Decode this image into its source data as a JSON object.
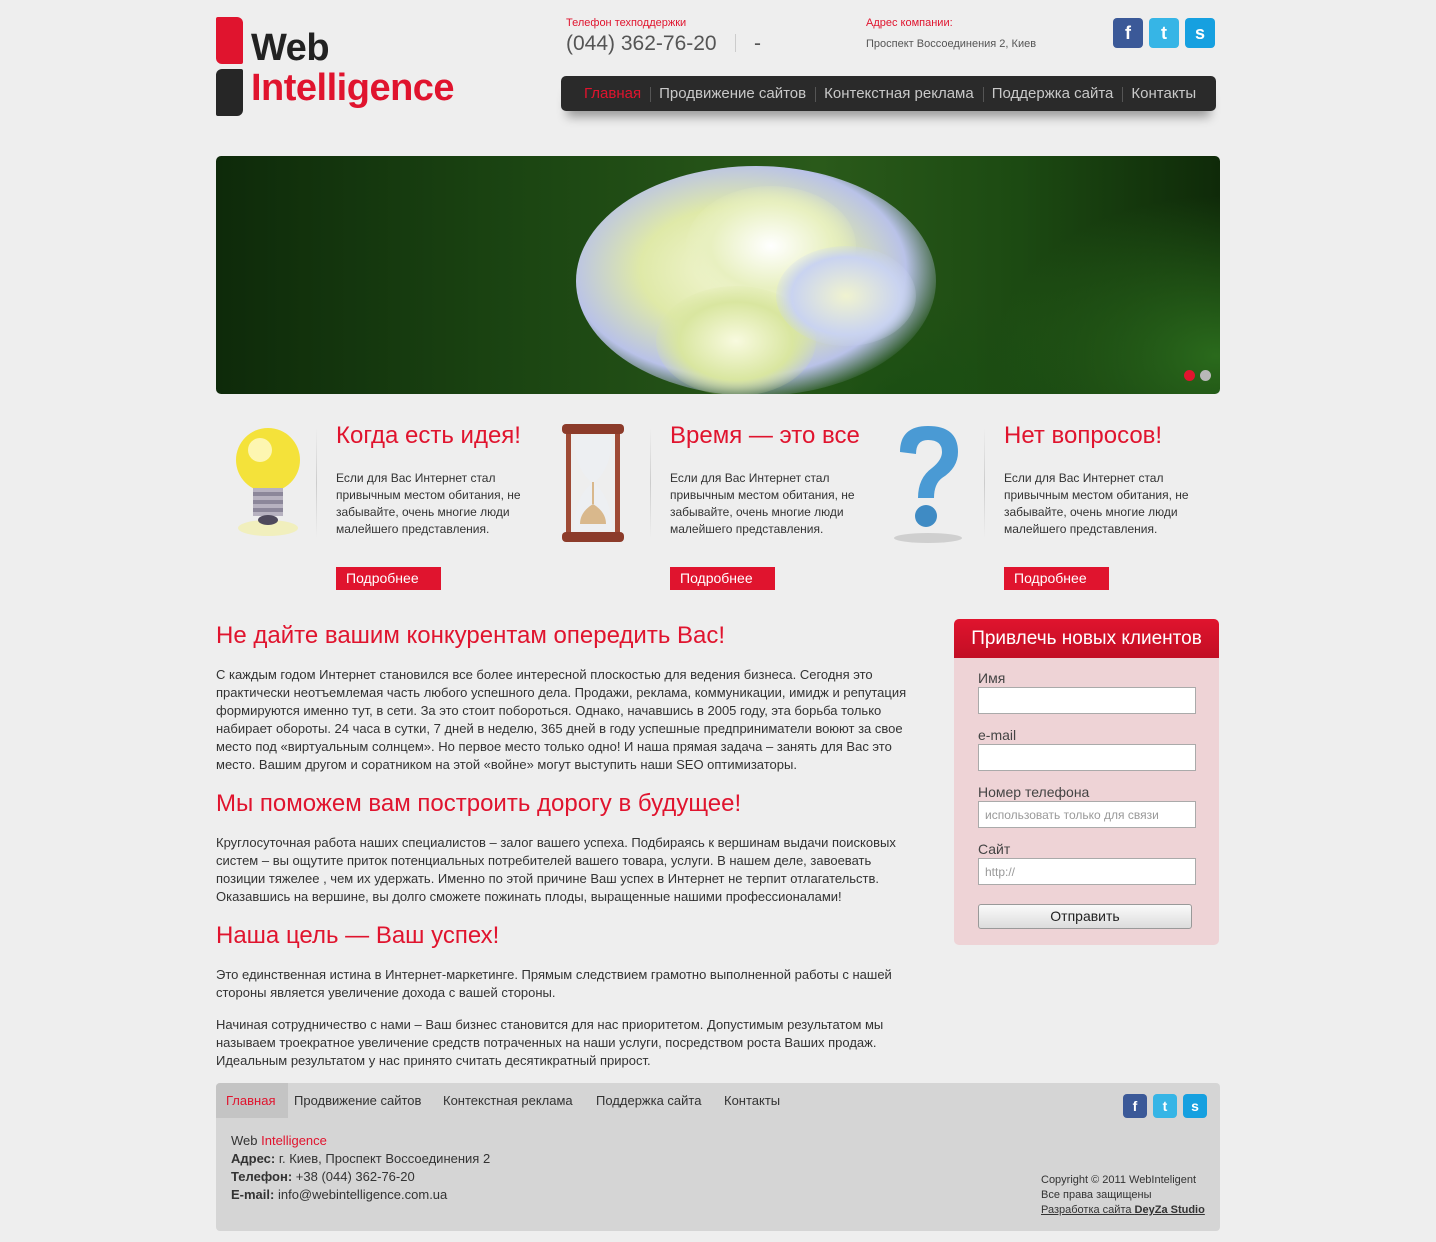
{
  "header": {
    "logo_word1": "Web",
    "logo_word2": "Intelligence",
    "phone_label": "Телефон техподдержки",
    "phone_number": "(044) 362-76-20",
    "phone_extra": "-",
    "address_label": "Адрес компании:",
    "address_value": "Проспект Воссоединения 2, Киев",
    "social": [
      {
        "name": "facebook-icon",
        "glyph": "f"
      },
      {
        "name": "twitter-icon",
        "glyph": "t"
      },
      {
        "name": "skype-icon",
        "glyph": "s"
      }
    ]
  },
  "nav": {
    "items": [
      "Главная",
      "Продвижение сайтов",
      "Контекстная реклама",
      "Поддержка сайта",
      "Контакты"
    ],
    "active_index": 0
  },
  "slider": {
    "slides_total": 2,
    "active_slide": 1,
    "active_color": "#e0142e",
    "inactive_color": "#b8b8b8"
  },
  "features": [
    {
      "icon": "lightbulb-icon",
      "title": "Когда есть идея!",
      "text": "Если для Вас Интернет стал привычным местом обитания, не забывайте, очень многие люди малейшего представления.",
      "button": "Подробнее"
    },
    {
      "icon": "hourglass-icon",
      "title": "Время — это все",
      "text": "Если для Вас Интернет стал привычным местом обитания, не забывайте, очень многие люди малейшего представления.",
      "button": "Подробнее"
    },
    {
      "icon": "question-mark-icon",
      "title": "Нет вопросов!",
      "text": "Если для Вас Интернет стал привычным местом обитания, не забывайте, очень многие люди малейшего представления.",
      "button": "Подробнее"
    }
  ],
  "content": {
    "h1": "Не дайте вашим конкурентам опередить Вас!",
    "p1": "С каждым годом Интернет становился все более интересной плоскостью для ведения бизнеса. Сегодня это практически неотъемлемая часть любого успешного дела. Продажи, реклама, коммуникации, имидж и репутация формируются именно тут, в сети. За это стоит побороться. Однако, начавшись в 2005 году, эта борьба только набирает обороты. 24 часа в сутки, 7 дней в неделю, 365 дней в году успешные предприниматели воюют за свое место под «виртуальным солнцем». Но первое место только одно! И наша прямая задача – занять для Вас это место. Вашим другом и соратником на этой «войне» могут выступить наши SEO оптимизаторы.",
    "h2": "Мы поможем вам построить дорогу в будущее!",
    "p2": "Круглосуточная работа наших специалистов – залог вашего успеха. Подбираясь к вершинам выдачи поисковых систем – вы ощутите приток потенциальных потребителей вашего товара, услуги. В нашем деле, завоевать позиции тяжелее , чем их удержать. Именно по этой причине Ваш успех в Интернет не терпит отлагательств. Оказавшись на вершине, вы долго сможете пожинать плоды, выращенные нашими профессионалами!",
    "h3": "Наша цель — Ваш успех!",
    "p3": "Это единственная истина в Интернет-маркетинге. Прямым следствием грамотно выполненной работы с нашей стороны является увеличение дохода с вашей стороны.",
    "p4": "Начиная сотрудничество с нами – Ваш бизнес становится для нас приоритетом. Допустимым результатом мы называем троекратное увеличение средств потраченных на наши услуги, посредством роста Ваших продаж. Идеальным результатом у нас принято считать десятикратный прирост."
  },
  "form": {
    "title": "Привлечь новых клиентов",
    "name_label": "Имя",
    "name_value": "",
    "email_label": "e-mail",
    "email_value": "",
    "phone_label": "Номер телефона",
    "phone_placeholder": "использовать только для связи",
    "site_label": "Сайт",
    "site_placeholder": "http://",
    "submit": "Отправить"
  },
  "footer": {
    "nav": [
      "Главная",
      "Продвижение сайтов",
      "Контекстная реклама",
      "Поддержка сайта",
      "Контакты"
    ],
    "brand_word1": "Web",
    "brand_word2": "Intelligence",
    "address_label": "Адрес:",
    "address_value": "г. Киев, Проспект Воссоединения 2",
    "phone_label": "Телефон:",
    "phone_value": "+38 (044) 362-76-20",
    "email_label": "E-mail:",
    "email_value": "info@webintelligence.com.ua",
    "copyright": "Copyright © 2011 WebInteligent",
    "rights": "Все права защищены",
    "dev_text": "Разработка сайта",
    "dev_name": "DeyZa Studio"
  },
  "colors": {
    "accent": "#e0142e",
    "nav_bg": "#2a2a2a",
    "page_bg": "#eeeeee",
    "form_bg": "#eed3d6",
    "footer_bg": "#d5d5d5"
  }
}
